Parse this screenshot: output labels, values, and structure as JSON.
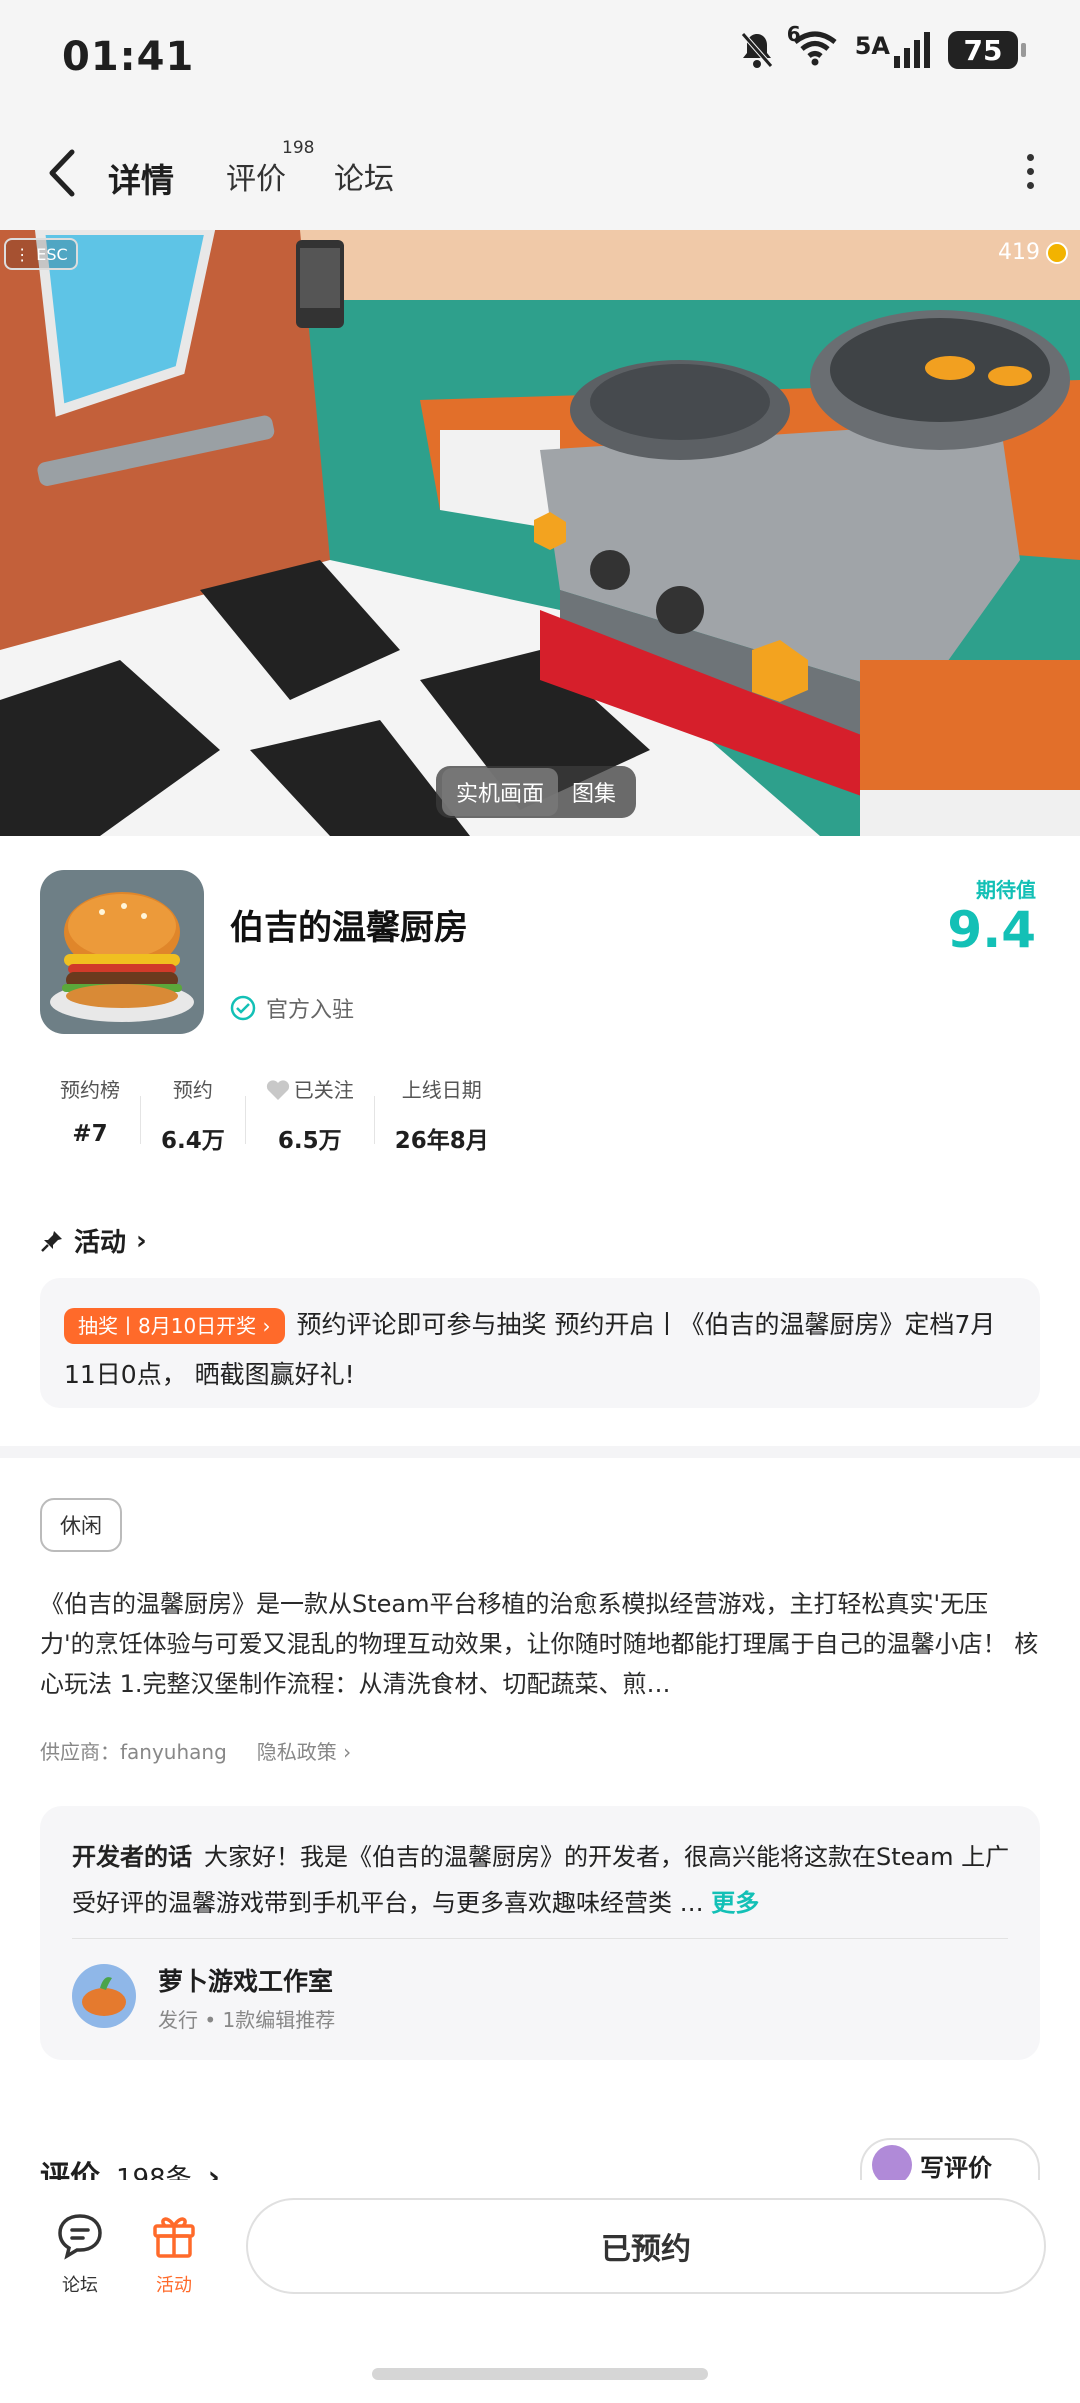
{
  "status_bar": {
    "time": "01:41",
    "network": "5A",
    "network_b": "6",
    "battery": "75"
  },
  "top_nav": {
    "tabs": [
      {
        "label": "详情"
      },
      {
        "label": "评价"
      },
      {
        "label": "论坛"
      }
    ],
    "review_count": "198"
  },
  "hero": {
    "esc_label": "ESC",
    "coins": "419",
    "switch": {
      "live_label": "实机画面",
      "gallery_label": "图集"
    }
  },
  "game": {
    "title": "伯吉的温馨厨房",
    "official_label": "官方入驻",
    "expect_label": "期待值",
    "expect_score": "9.4"
  },
  "stats": [
    {
      "label": "预约榜",
      "value": "#7"
    },
    {
      "label": "预约",
      "value": "6.4万"
    },
    {
      "label": "已关注",
      "value": "6.5万"
    },
    {
      "label": "上线日期",
      "value": "26年8月"
    }
  ],
  "activity": {
    "title": "活动",
    "badge": "抽奖丨8月10日开奖 ›",
    "text": "预约评论即可参与抽奖 预约开启丨《伯吉的温馨厨房》定档7月11日0点， 晒截图赢好礼!"
  },
  "tag": "休闲",
  "description": "《伯吉的温馨厨房》是一款从Steam平台移植的治愈系模拟经营游戏，主打轻松真实'无压力'的烹饪体验与可爱又混乱的物理互动效果，让你随时随地都能打理属于自己的温馨小店！ 核心玩法 1.完整汉堡制作流程：从清洗食材、切配蔬菜、煎…",
  "supplier": {
    "label": "供应商：fanyuhang",
    "privacy": "隐私政策 ›"
  },
  "developer": {
    "heading": "开发者的话",
    "text": "大家好！我是《伯吉的温馨厨房》的开发者，很高兴能将这款在Steam 上广受好评的温馨游戏带到手机平台，与更多喜欢趣味经营类 …",
    "more": "更多",
    "studio_name": "萝卜游戏工作室",
    "studio_sub": "发行 • 1款编辑推荐"
  },
  "reviews": {
    "title": "评价",
    "count": "198条",
    "write_label": "写评价"
  },
  "bottom": {
    "forum_label": "论坛",
    "activity_label": "活动",
    "reserved_label": "已预约"
  }
}
